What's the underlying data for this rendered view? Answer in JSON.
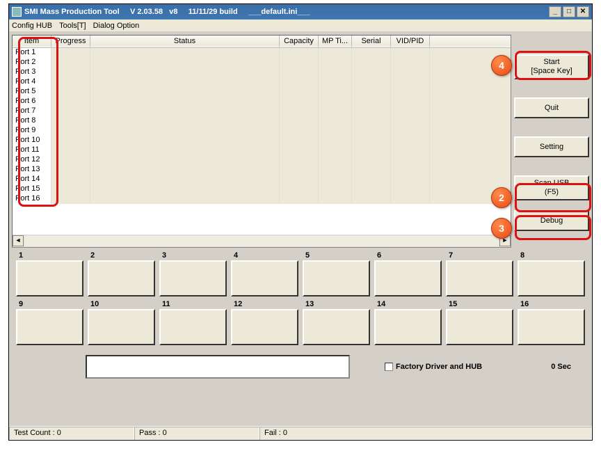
{
  "title_parts": {
    "app": "SMI Mass Production Tool",
    "ver": "V 2.03.58",
    "v8": "v8",
    "build": "11/11/29 build",
    "ini": "___default.ini___"
  },
  "menu": {
    "config": "Config HUB",
    "tools": "Tools[T]",
    "dialog": "Dialog Option"
  },
  "columns": [
    "Item",
    "Progress",
    "Status",
    "Capacity",
    "MP Ti...",
    "Serial",
    "VID/PID"
  ],
  "ports": [
    "Port 1",
    "Port 2",
    "Port 3",
    "Port 4",
    "Port 5",
    "Port 6",
    "Port 7",
    "Port 8",
    "Port 9",
    "Port 10",
    "Port 11",
    "Port 12",
    "Port 13",
    "Port 14",
    "Port 15",
    "Port 16"
  ],
  "buttons": {
    "start_l1": "Start",
    "start_l2": "[Space Key]",
    "quit": "Quit",
    "setting": "Setting",
    "scan_l1": "Scan USB",
    "scan_l2": "(F5)",
    "debug": "Debug"
  },
  "slots": [
    "1",
    "2",
    "3",
    "4",
    "5",
    "6",
    "7",
    "8",
    "9",
    "10",
    "11",
    "12",
    "13",
    "14",
    "15",
    "16"
  ],
  "factory_label": "Factory Driver and HUB",
  "timer": "0 Sec",
  "status": {
    "test": "Test Count : 0",
    "pass": "Pass : 0",
    "fail": "Fail : 0"
  },
  "callouts": {
    "c2": "2",
    "c3": "3",
    "c4": "4"
  }
}
